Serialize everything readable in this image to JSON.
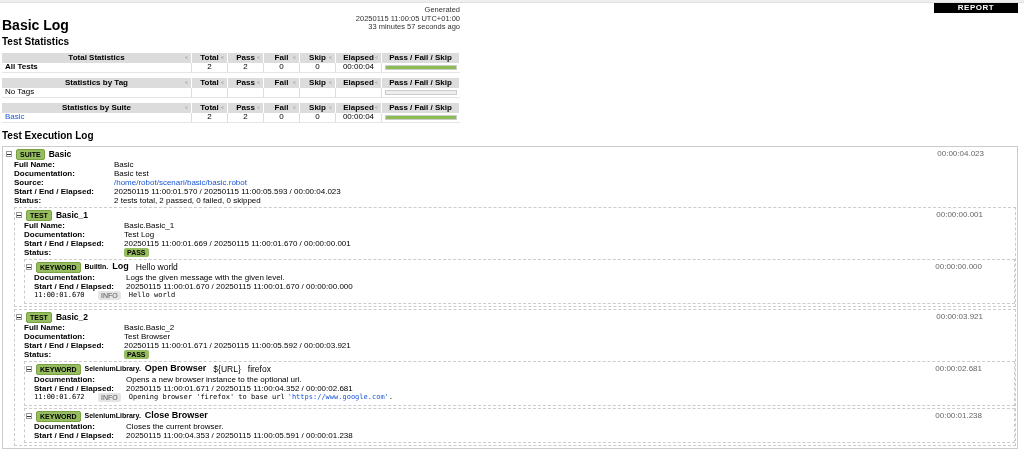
{
  "report_button": "REPORT",
  "title": "Basic Log",
  "generated": [
    "Generated",
    "20250115 11:00:05 UTC+01:00",
    "33 minutes 57 seconds ago"
  ],
  "statistics": {
    "title": "Test Statistics",
    "tables": [
      {
        "columns": [
          "Total Statistics",
          "Total",
          "Pass",
          "Fail",
          "Skip",
          "Elapsed",
          "Pass / Fail / Skip"
        ],
        "rows": [
          {
            "name": "All Tests",
            "kind": "bold",
            "total": "2",
            "pass": "2",
            "fail": "0",
            "skip": "0",
            "elapsed": "00:00:04",
            "level": 1
          }
        ]
      },
      {
        "columns": [
          "Statistics by Tag",
          "Total",
          "Pass",
          "Fail",
          "Skip",
          "Elapsed",
          "Pass / Fail / Skip"
        ],
        "rows": [
          {
            "name": "No Tags",
            "kind": "plain"
          }
        ]
      },
      {
        "columns": [
          "Statistics by Suite",
          "Total",
          "Pass",
          "Fail",
          "Skip",
          "Elapsed",
          "Pass / Fail / Skip"
        ],
        "rows": [
          {
            "name": "Basic",
            "kind": "link",
            "total": "2",
            "pass": "2",
            "fail": "0",
            "skip": "0",
            "elapsed": "00:00:04",
            "level": 1
          }
        ]
      }
    ]
  },
  "log": {
    "title": "Test Execution Log",
    "items": [
      {
        "kind": "suite",
        "badge": "SUITE",
        "name": "Basic",
        "elapsed": "00:00:04.023",
        "expanded": true,
        "fields": [
          {
            "label": "Full Name:",
            "value": "Basic",
            "kind": "text"
          },
          {
            "label": "Documentation:",
            "value": "Basic test",
            "kind": "text"
          },
          {
            "label": "Source:",
            "value": "/home/robot/scenari/basic/basic.robot",
            "kind": "link"
          },
          {
            "label": "Start / End / Elapsed:",
            "value": "20250115 11:00:01.570 / 20250115 11:00:05.593 / 00:00:04.023",
            "kind": "text"
          },
          {
            "label": "Status:",
            "value": "2 tests total, 2 passed, 0 failed, 0 skipped",
            "kind": "text"
          }
        ],
        "children": [
          {
            "kind": "test",
            "badge": "TEST",
            "name": "Basic_1",
            "elapsed": "00:00:00.001",
            "expanded": true,
            "fields": [
              {
                "label": "Full Name:",
                "value": "Basic.Basic_1",
                "kind": "text"
              },
              {
                "label": "Documentation:",
                "value": "Test Log",
                "kind": "text"
              },
              {
                "label": "Start / End / Elapsed:",
                "value": "20250115 11:00:01.669 / 20250115 11:00:01.670 / 00:00:00.001",
                "kind": "text"
              },
              {
                "label": "Status:",
                "value": "PASS",
                "kind": "status"
              }
            ],
            "children": [
              {
                "kind": "keyword",
                "badge": "KEYWORD",
                "library": "BuiltIn.",
                "name": "Log",
                "args": [
                  "Hello world"
                ],
                "elapsed": "00:00:00.000",
                "expanded": true,
                "fields": [
                  {
                    "label": "Documentation:",
                    "value": "Logs the given message with the given level.",
                    "kind": "text"
                  },
                  {
                    "label": "Start / End / Elapsed:",
                    "value": "20250115 11:00:01.670 / 20250115 11:00:01.670 / 00:00:00.000",
                    "kind": "text"
                  }
                ],
                "messages": [
                  {
                    "time": "11:00:01.670",
                    "level": "INFO",
                    "text": "Hello world"
                  }
                ]
              }
            ]
          },
          {
            "kind": "test",
            "badge": "TEST",
            "name": "Basic_2",
            "elapsed": "00:00:03.921",
            "expanded": true,
            "fields": [
              {
                "label": "Full Name:",
                "value": "Basic.Basic_2",
                "kind": "text"
              },
              {
                "label": "Documentation:",
                "value": "Test Browser",
                "kind": "text"
              },
              {
                "label": "Start / End / Elapsed:",
                "value": "20250115 11:00:01.671 / 20250115 11:00:05.592 / 00:00:03.921",
                "kind": "text"
              },
              {
                "label": "Status:",
                "value": "PASS",
                "kind": "status"
              }
            ],
            "children": [
              {
                "kind": "keyword",
                "badge": "KEYWORD",
                "library": "SeleniumLibrary.",
                "name": "Open Browser",
                "args": [
                  "${URL}",
                  "firefox"
                ],
                "elapsed": "00:00:02.681",
                "expanded": true,
                "fields": [
                  {
                    "label": "Documentation:",
                    "value": "Opens a new browser instance to the optional url.",
                    "kind": "text"
                  },
                  {
                    "label": "Start / End / Elapsed:",
                    "value": "20250115 11:00:01.671 / 20250115 11:00:04.352 / 00:00:02.681",
                    "kind": "text"
                  }
                ],
                "messages": [
                  {
                    "time": "11:00:01.672",
                    "level": "INFO",
                    "text": "Opening browser 'firefox' to base url",
                    "link": "'https://www.google.com'",
                    "after": "."
                  }
                ]
              },
              {
                "kind": "keyword",
                "badge": "KEYWORD",
                "library": "SeleniumLibrary.",
                "name": "Close Browser",
                "elapsed": "00:00:01.238",
                "expanded": true,
                "fields": [
                  {
                    "label": "Documentation:",
                    "value": "Closes the current browser.",
                    "kind": "text"
                  },
                  {
                    "label": "Start / End / Elapsed:",
                    "value": "20250115 11:00:04.353 / 20250115 11:00:05.591 / 00:00:01.238",
                    "kind": "text"
                  }
                ]
              }
            ]
          }
        ]
      }
    ]
  }
}
